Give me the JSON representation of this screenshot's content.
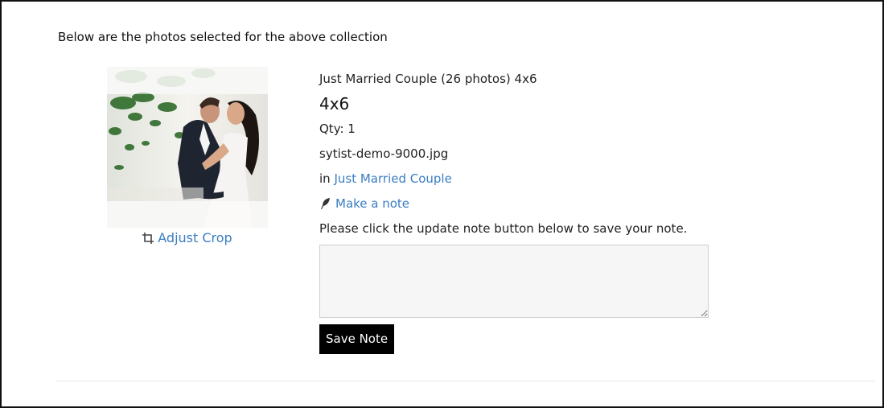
{
  "intro_text": "Below are the photos selected for the above collection",
  "item": {
    "photo_alt": "Just Married Couple",
    "adjust_crop_label": "Adjust Crop",
    "collection_title": "Just Married Couple (26 photos) 4x6",
    "size": "4x6",
    "qty": "Qty: 1",
    "filename": "sytist-demo-9000.jpg",
    "in_prefix": "in",
    "gallery_link": "Just Married Couple",
    "make_note_label": "Make a note",
    "note_instructions": "Please click the update note button below to save your note.",
    "note_value": "",
    "save_note_label": "Save Note"
  },
  "icons": {
    "crop": "crop-icon",
    "note": "feather-icon"
  },
  "colors": {
    "link": "#3b7dc1",
    "button_bg": "#000000",
    "button_text": "#ffffff",
    "textarea_bg": "#f6f6f6"
  }
}
